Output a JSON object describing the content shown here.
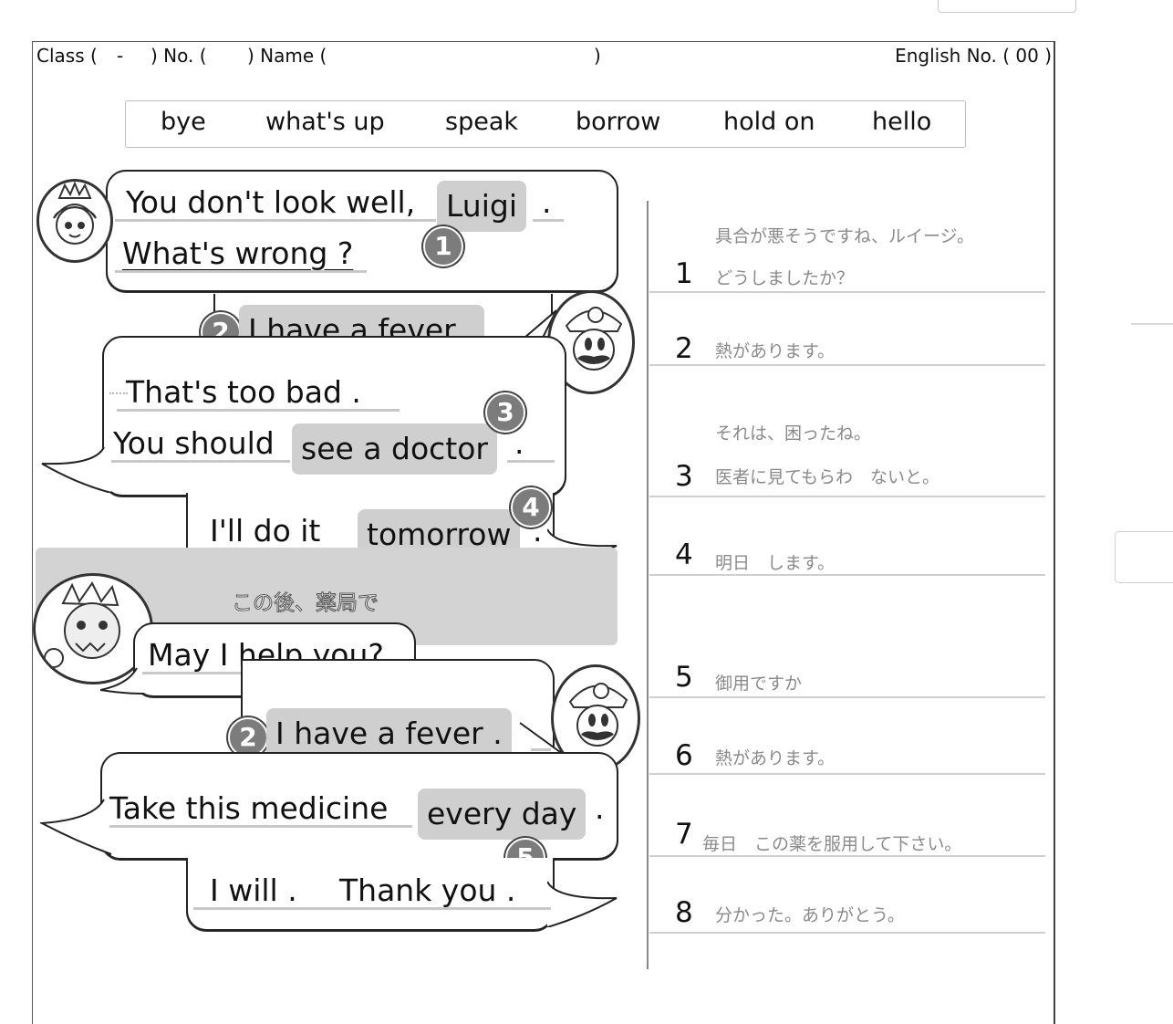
{
  "header": {
    "class_label": "Class (",
    "class_dash": "-",
    "no_label": ") No. (",
    "name_label": ") Name (",
    "name_close": ")",
    "english_no": "English No. ( 00 )"
  },
  "word_bank": [
    "bye",
    "what's up",
    "speak",
    "borrow",
    "hold on",
    "hello"
  ],
  "dialogue": {
    "b1_line1": "You don't look well,",
    "b1_ans": "Luigi",
    "b1_end": ".",
    "b1_line2": "What's wrong ?",
    "b2_text": "I have a fever .",
    "b3_line1": "That's too bad .",
    "b3_line2": "You should",
    "b3_ans": "see a doctor",
    "b3_end": ".",
    "b4_line": "I'll do it",
    "b4_ans": "tomorrow",
    "b4_end": ".",
    "scene_caption": "この後、薬局で",
    "b5_text": "May I help you?",
    "b6_text": "I have a fever .",
    "b7_line": "Take this medicine",
    "b7_ans": "every day",
    "b7_end": ".",
    "b8_a": "I will .",
    "b8_b": "Thank you ."
  },
  "badges": [
    "1",
    "2",
    "3",
    "4",
    "2",
    "5"
  ],
  "translations": [
    {
      "num": "1",
      "lines": [
        "具合が悪そうですね、ルイージ。",
        "どうしましたか？"
      ]
    },
    {
      "num": "2",
      "lines": [
        "熱があります。"
      ]
    },
    {
      "num": "3",
      "lines": [
        "それは、困ったね。",
        "医者に見てもらわ　ないと。"
      ]
    },
    {
      "num": "4",
      "lines": [
        "明日　します。"
      ]
    },
    {
      "num": "5",
      "lines": [
        "御用ですか"
      ]
    },
    {
      "num": "6",
      "lines": [
        "熱があります。"
      ]
    },
    {
      "num": "7",
      "lines": [
        "毎日　この薬を服用して下さい。"
      ]
    },
    {
      "num": "8",
      "lines": [
        "分かった。ありがとう。"
      ]
    }
  ],
  "avatars": [
    "princess-peach-icon",
    "luigi-icon",
    "bowser-icon",
    "luigi-icon"
  ]
}
